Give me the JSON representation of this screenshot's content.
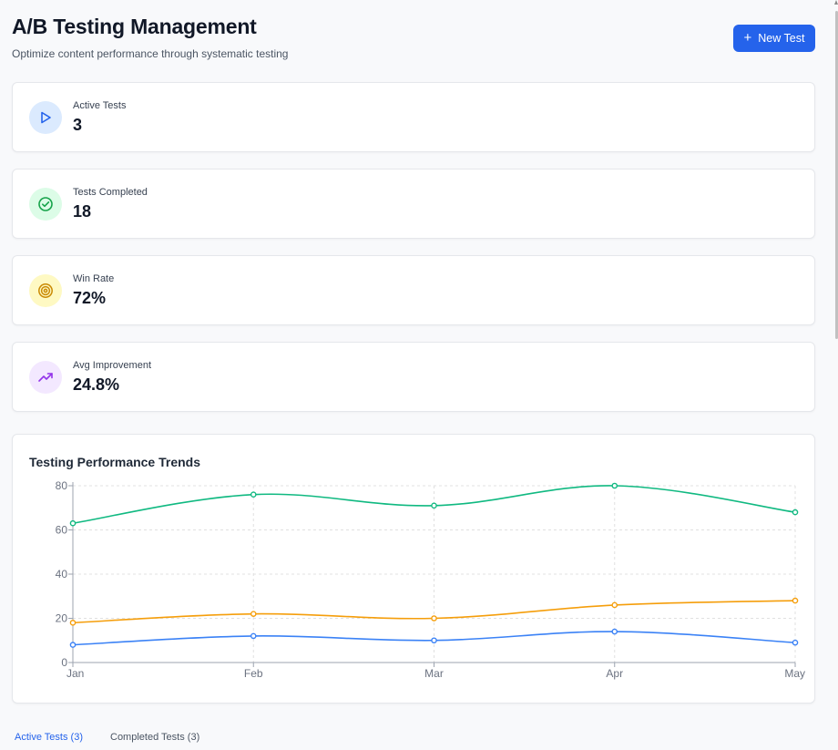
{
  "header": {
    "title": "A/B Testing Management",
    "subtitle": "Optimize content performance through systematic testing",
    "new_test_label": "New Test"
  },
  "stats": [
    {
      "label": "Active Tests",
      "value": "3",
      "icon": "play-icon",
      "icon_bg": "#dbeafe",
      "icon_color": "#2563eb"
    },
    {
      "label": "Tests Completed",
      "value": "18",
      "icon": "check-circle-icon",
      "icon_bg": "#dcfce7",
      "icon_color": "#16a34a"
    },
    {
      "label": "Win Rate",
      "value": "72%",
      "icon": "target-icon",
      "icon_bg": "#fef9c3",
      "icon_color": "#ca8a04"
    },
    {
      "label": "Avg Improvement",
      "value": "24.8%",
      "icon": "trending-up-icon",
      "icon_bg": "#f3e8ff",
      "icon_color": "#9333ea"
    }
  ],
  "chart": {
    "title": "Testing Performance Trends"
  },
  "chart_data": {
    "type": "line",
    "categories": [
      "Jan",
      "Feb",
      "Mar",
      "Apr",
      "May"
    ],
    "ylim": [
      0,
      80
    ],
    "yticks": [
      0,
      20,
      40,
      60,
      80
    ],
    "grid": true,
    "series": [
      {
        "values": [
          63,
          76,
          71,
          80,
          68
        ],
        "color": "#10b981"
      },
      {
        "values": [
          18,
          22,
          20,
          26,
          28
        ],
        "color": "#f59e0b"
      },
      {
        "values": [
          8,
          12,
          10,
          14,
          9
        ],
        "color": "#3b82f6"
      }
    ]
  },
  "tabs": [
    {
      "label": "Active Tests (3)",
      "active": true
    },
    {
      "label": "Completed Tests (3)",
      "active": false
    }
  ]
}
